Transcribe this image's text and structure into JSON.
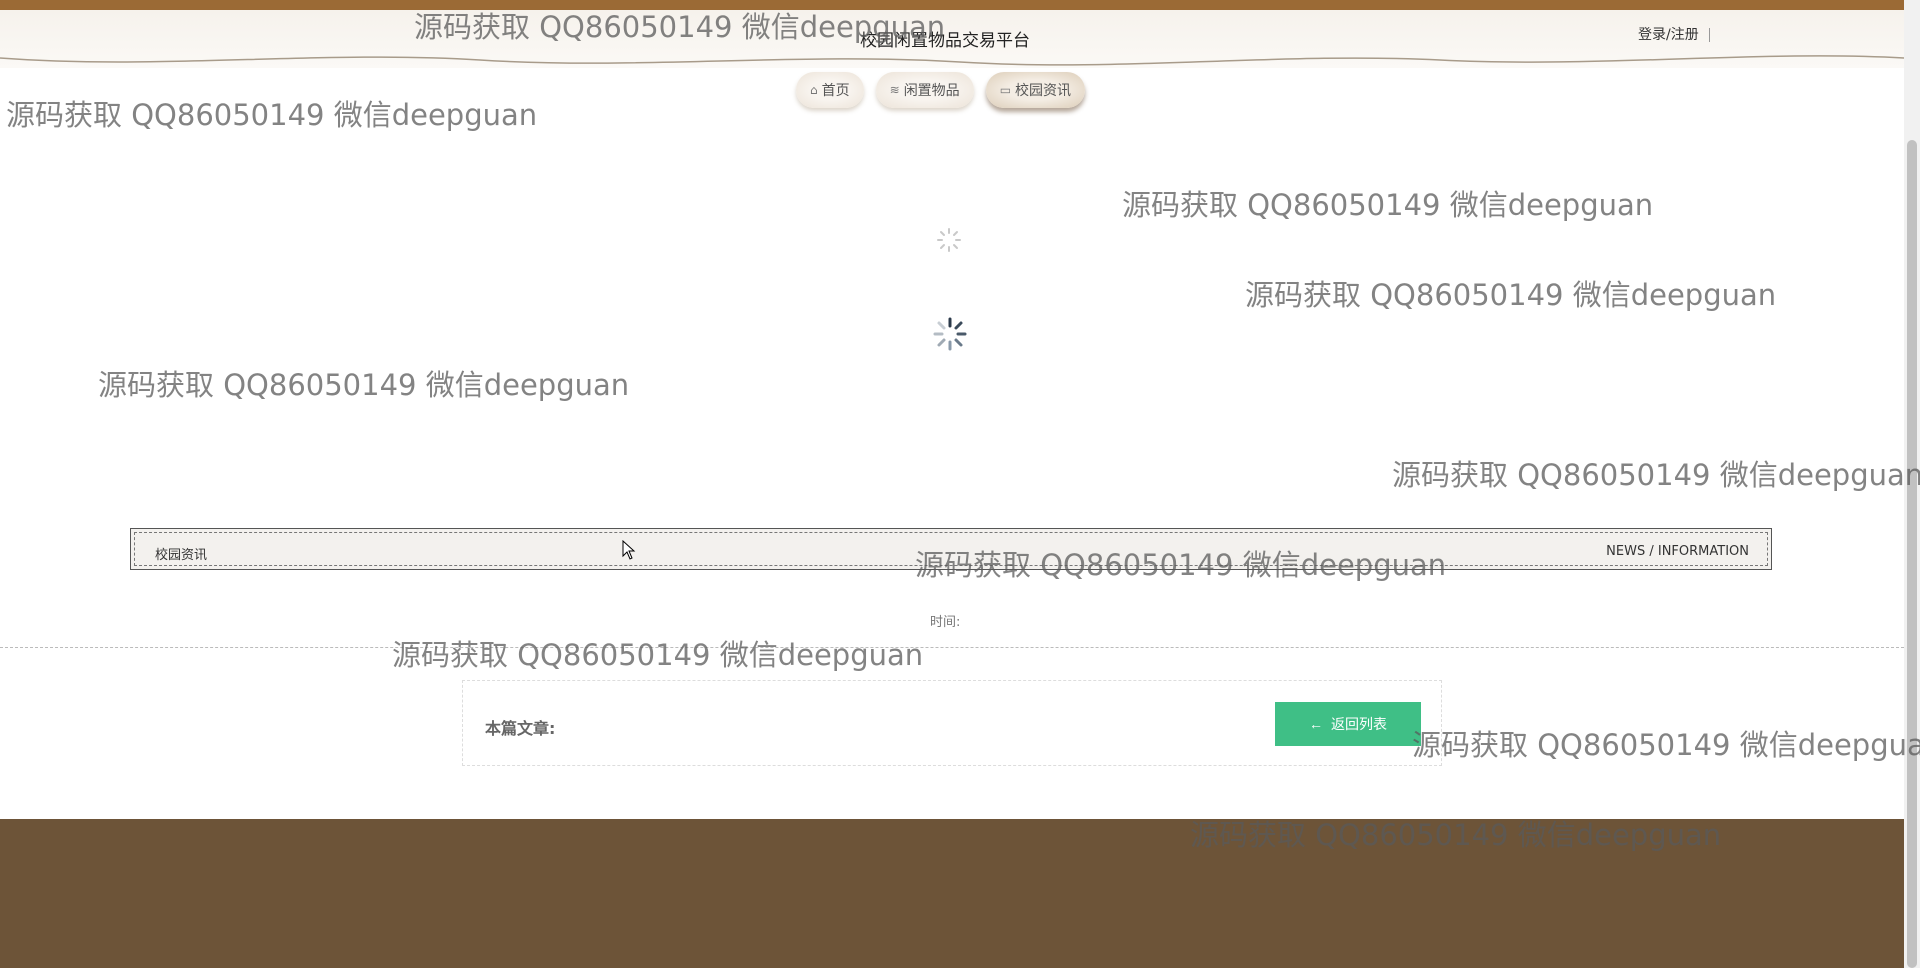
{
  "header": {
    "site_title": "校园闲置物品交易平台",
    "auth_link": "登录/注册"
  },
  "nav": {
    "items": [
      {
        "label": "首页",
        "icon": "home-icon"
      },
      {
        "label": "闲置物品",
        "icon": "stack-icon"
      },
      {
        "label": "校园资讯",
        "icon": "book-icon",
        "active": true
      }
    ]
  },
  "section": {
    "title": "校园资讯",
    "subtitle": "NEWS / INFORMATION"
  },
  "article": {
    "time_label": "时间:",
    "this_article_label": "本篇文章:",
    "back_button": "返回列表"
  },
  "watermark": {
    "text": "源码获取 QQ86050149 微信deepguan"
  },
  "colors": {
    "top_band": "#9b6a35",
    "footer": "#6d5438",
    "back_button": "#3fbf86"
  }
}
